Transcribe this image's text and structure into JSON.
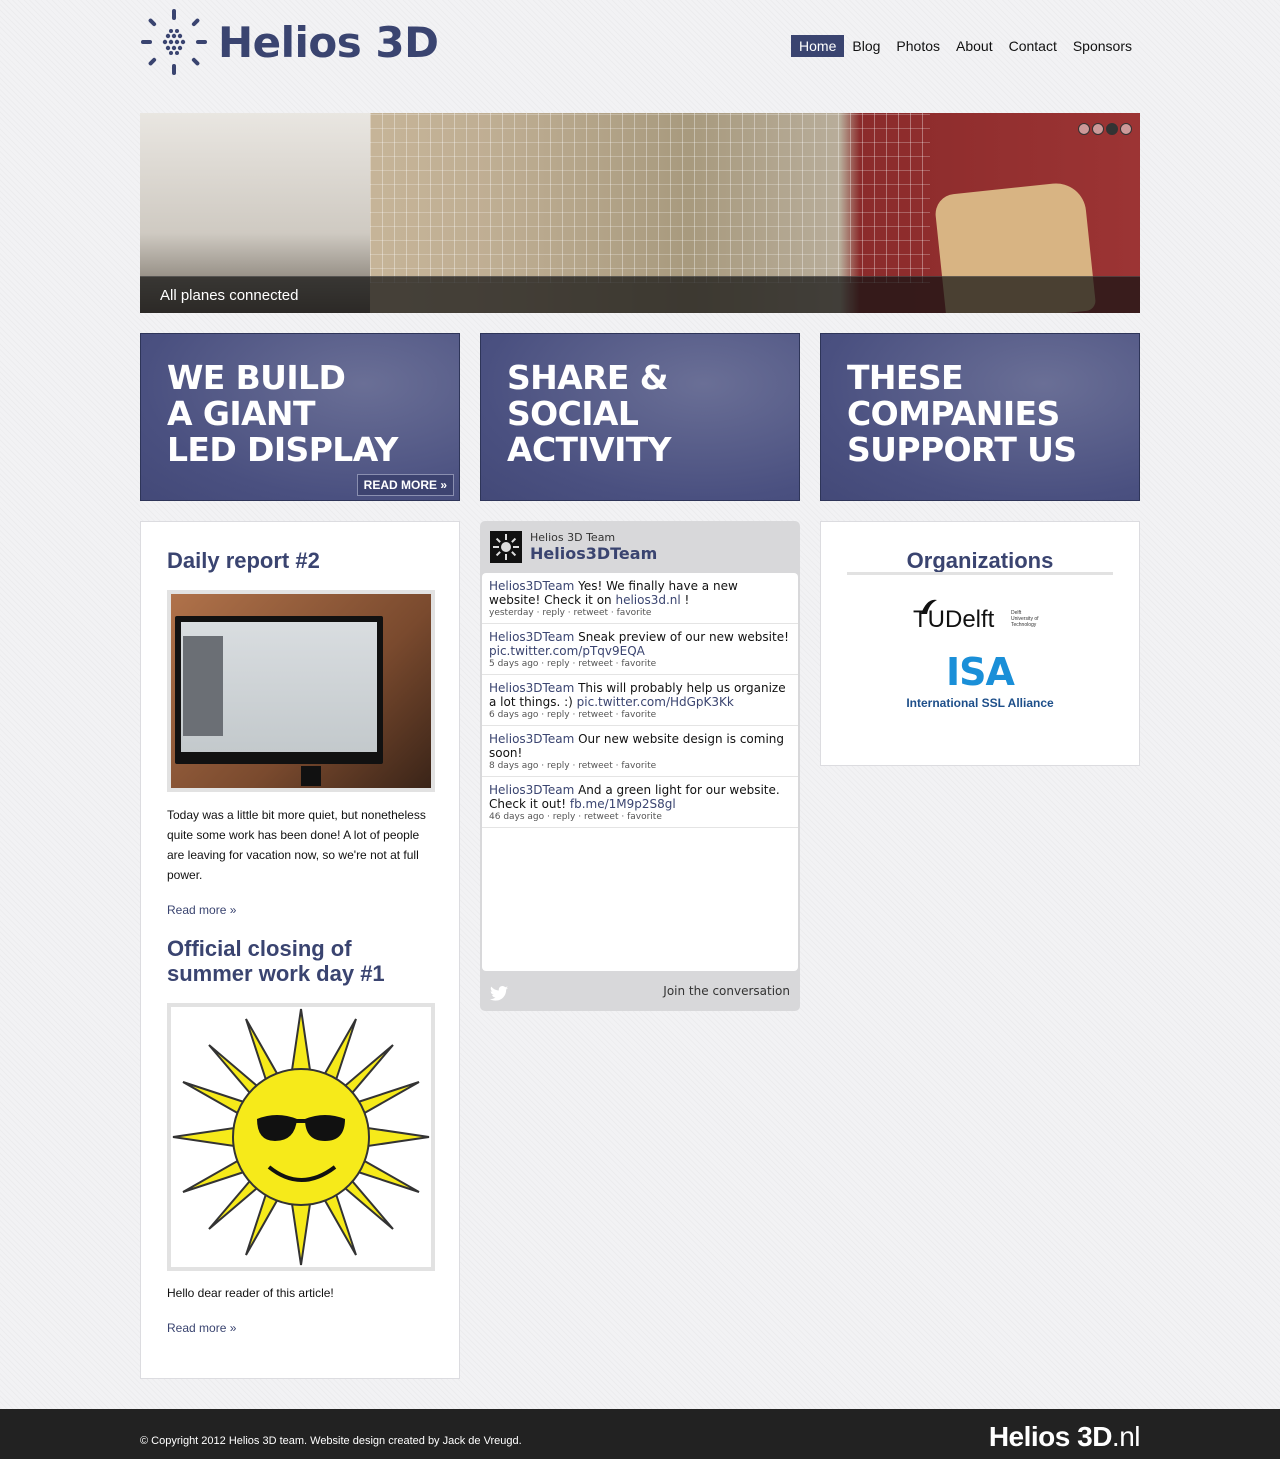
{
  "site": {
    "name": "Helios 3D"
  },
  "nav": {
    "items": [
      "Home",
      "Blog",
      "Photos",
      "About",
      "Contact",
      "Sponsors"
    ],
    "active": "Home"
  },
  "slider": {
    "caption": "All planes connected",
    "slides": 4,
    "current": 3
  },
  "promos": [
    {
      "lines": [
        "We build",
        "a giant",
        "LED display"
      ],
      "button": "READ MORE »"
    },
    {
      "lines": [
        "Share &",
        "social",
        "activity"
      ]
    },
    {
      "lines": [
        "These",
        "companies",
        "support us"
      ]
    }
  ],
  "posts": [
    {
      "title": "Daily report #2",
      "text": "Today was a little bit more quiet, but nonetheless quite some work has been done! A lot of people are leaving for vacation now, so we're not at full power.",
      "read_more": "Read more »"
    },
    {
      "title": "Official closing of summer work day #1",
      "text": "Hello dear reader of this article!",
      "read_more": "Read more »"
    }
  ],
  "twitter": {
    "display_name": "Helios 3D Team",
    "handle": "Helios3DTeam",
    "tweets": [
      {
        "user": "Helios3DTeam",
        "text": " Yes! We finally have a new website! Check it on ",
        "link": "helios3d.nl",
        "after": " !",
        "time": "yesterday"
      },
      {
        "user": "Helios3DTeam",
        "text": " Sneak preview of our new website! ",
        "link": "pic.twitter.com/pTqv9EQA",
        "after": "",
        "time": "5 days ago"
      },
      {
        "user": "Helios3DTeam",
        "text": " This will probably help us organize a lot things. :) ",
        "link": "pic.twitter.com/HdGpK3Kk",
        "after": "",
        "time": "6 days ago"
      },
      {
        "user": "Helios3DTeam",
        "text": " Our new website design is coming soon!",
        "link": "",
        "after": "",
        "time": "8 days ago"
      },
      {
        "user": "Helios3DTeam",
        "text": " And a green light for our website. Check it out! ",
        "link": "fb.me/1M9p2S8gl",
        "after": "",
        "time": "46 days ago"
      }
    ],
    "actions": [
      "reply",
      "retweet",
      "favorite"
    ],
    "join": "Join the conversation"
  },
  "organizations": {
    "title": "Organizations",
    "logos": [
      {
        "name": "TU Delft",
        "big": "TUDelft",
        "small": [
          "Delft",
          "University of",
          "Technology"
        ]
      },
      {
        "name": "ISA",
        "big": "ISA",
        "small": [
          "International SSL Alliance"
        ]
      }
    ]
  },
  "footer": {
    "copyright": "© Copyright 2012 Helios 3D team. Website design created by Jack de Vreugd.",
    "brand": "Helios 3D",
    "brand_tld": ".nl"
  },
  "colors": {
    "brand": "#3a4470",
    "footer_bg": "#222222"
  }
}
